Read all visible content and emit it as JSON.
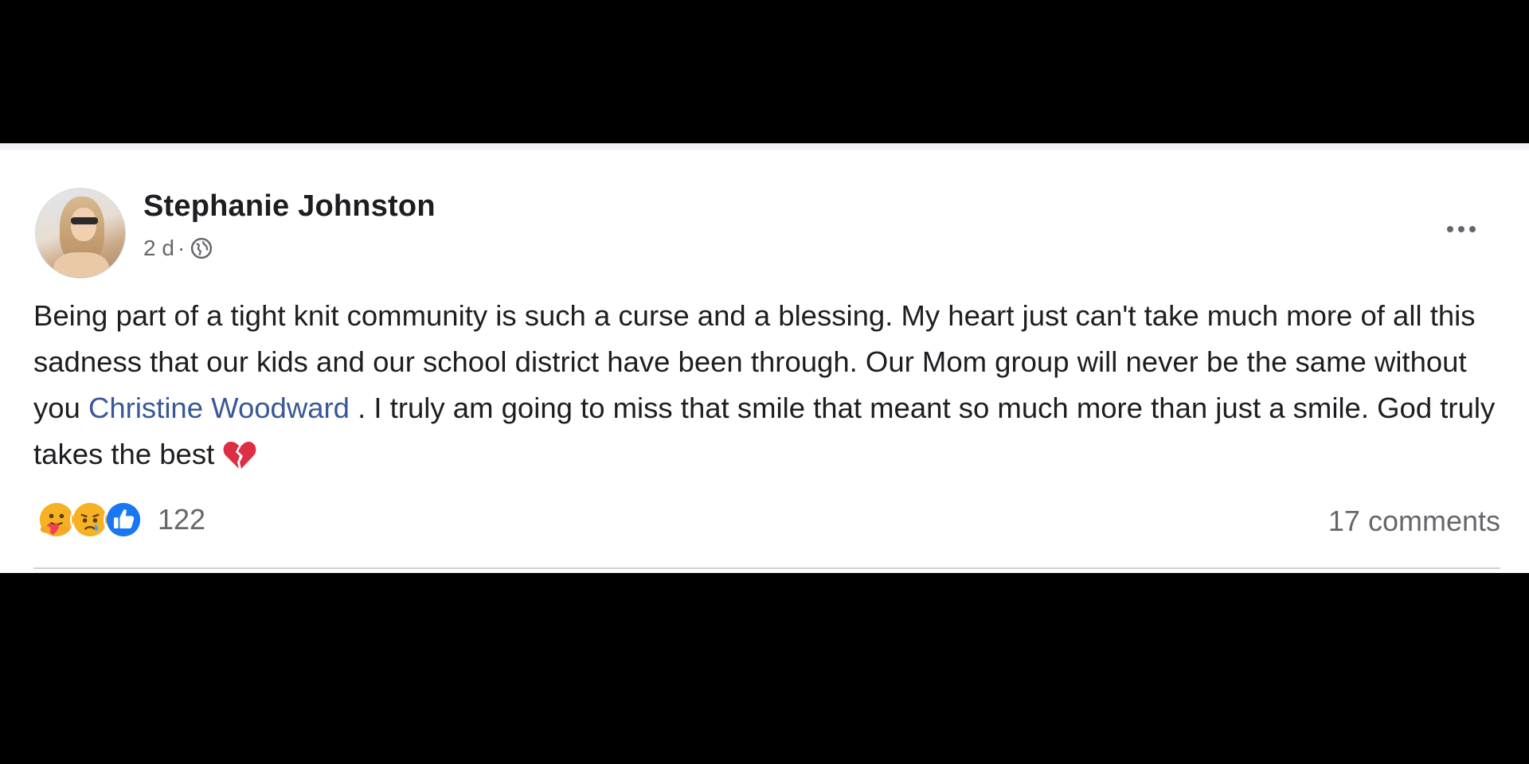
{
  "post": {
    "author": "Stephanie Johnston",
    "time": "2 d",
    "separator": "·",
    "privacy_icon": "globe-icon",
    "more_icon": "more-options-icon",
    "body_before_mention": "Being part of a tight knit community is such a curse and a blessing. My heart just can't take much more of all this sadness that our kids and our school district have been through. Our Mom group will never be the same without you ",
    "mention": "Christine Woodward",
    "body_after_mention": " . I truly am going to miss that smile that meant so much more than just a smile. God truly takes the best ",
    "emoji_icon": "broken-heart-icon",
    "link_color": "#385898"
  },
  "reactions": {
    "icons": [
      "care-reaction-icon",
      "sad-reaction-icon",
      "like-reaction-icon"
    ],
    "count": "122"
  },
  "comments": {
    "label": "17 comments"
  }
}
